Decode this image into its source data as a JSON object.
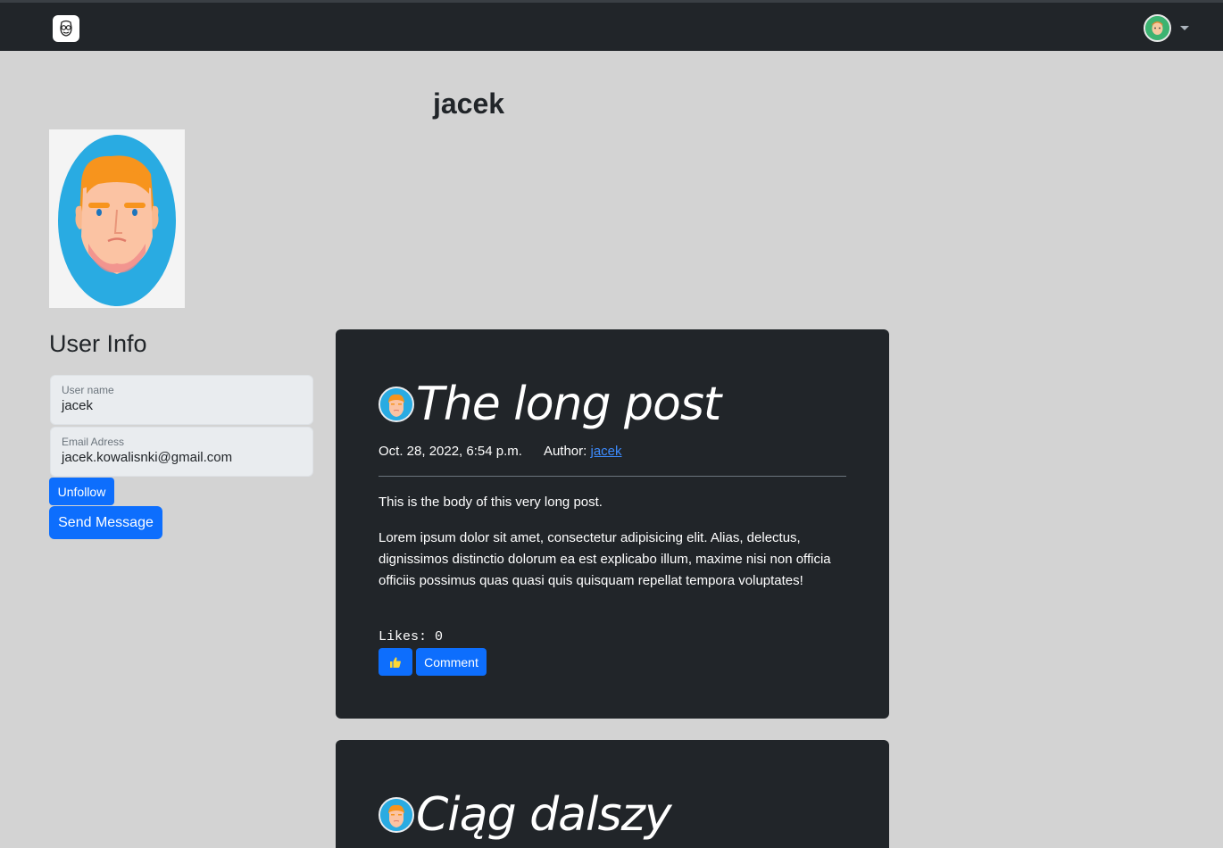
{
  "navbar": {
    "brand_icon": "face-glasses-logo-icon",
    "user_avatar_icon": "user-avatar-icon"
  },
  "profile": {
    "username_heading": "jacek",
    "section_heading": "User Info",
    "fields": [
      {
        "label": "User name",
        "value": "jacek"
      },
      {
        "label": "Email Adress",
        "value": "jacek.kowalisnki@gmail.com"
      }
    ],
    "unfollow_label": "Unfollow",
    "send_message_label": "Send Message"
  },
  "posts": [
    {
      "title": "The long post",
      "date": "Oct. 28, 2022, 6:54 p.m.",
      "author_label": "Author:",
      "author": "jacek",
      "body": [
        "This is the body of this very long post.",
        "Lorem ipsum dolor sit amet, consectetur adipisicing elit. Alias, delectus, dignissimos distinctio dolorum ea est explicabo illum, maxime nisi non officia officiis possimus quas quasi quis quisquam repellat tempora voluptates!"
      ],
      "likes": "Likes: 0",
      "like_icon": "thumbs-up-icon",
      "comment_label": "Comment"
    },
    {
      "title": "Ciąg dalszy"
    }
  ],
  "colors": {
    "background": "#d3d3d3",
    "navbar": "#212529",
    "card": "#212529",
    "primary": "#0d6efd",
    "link": "#3d8bfd"
  }
}
